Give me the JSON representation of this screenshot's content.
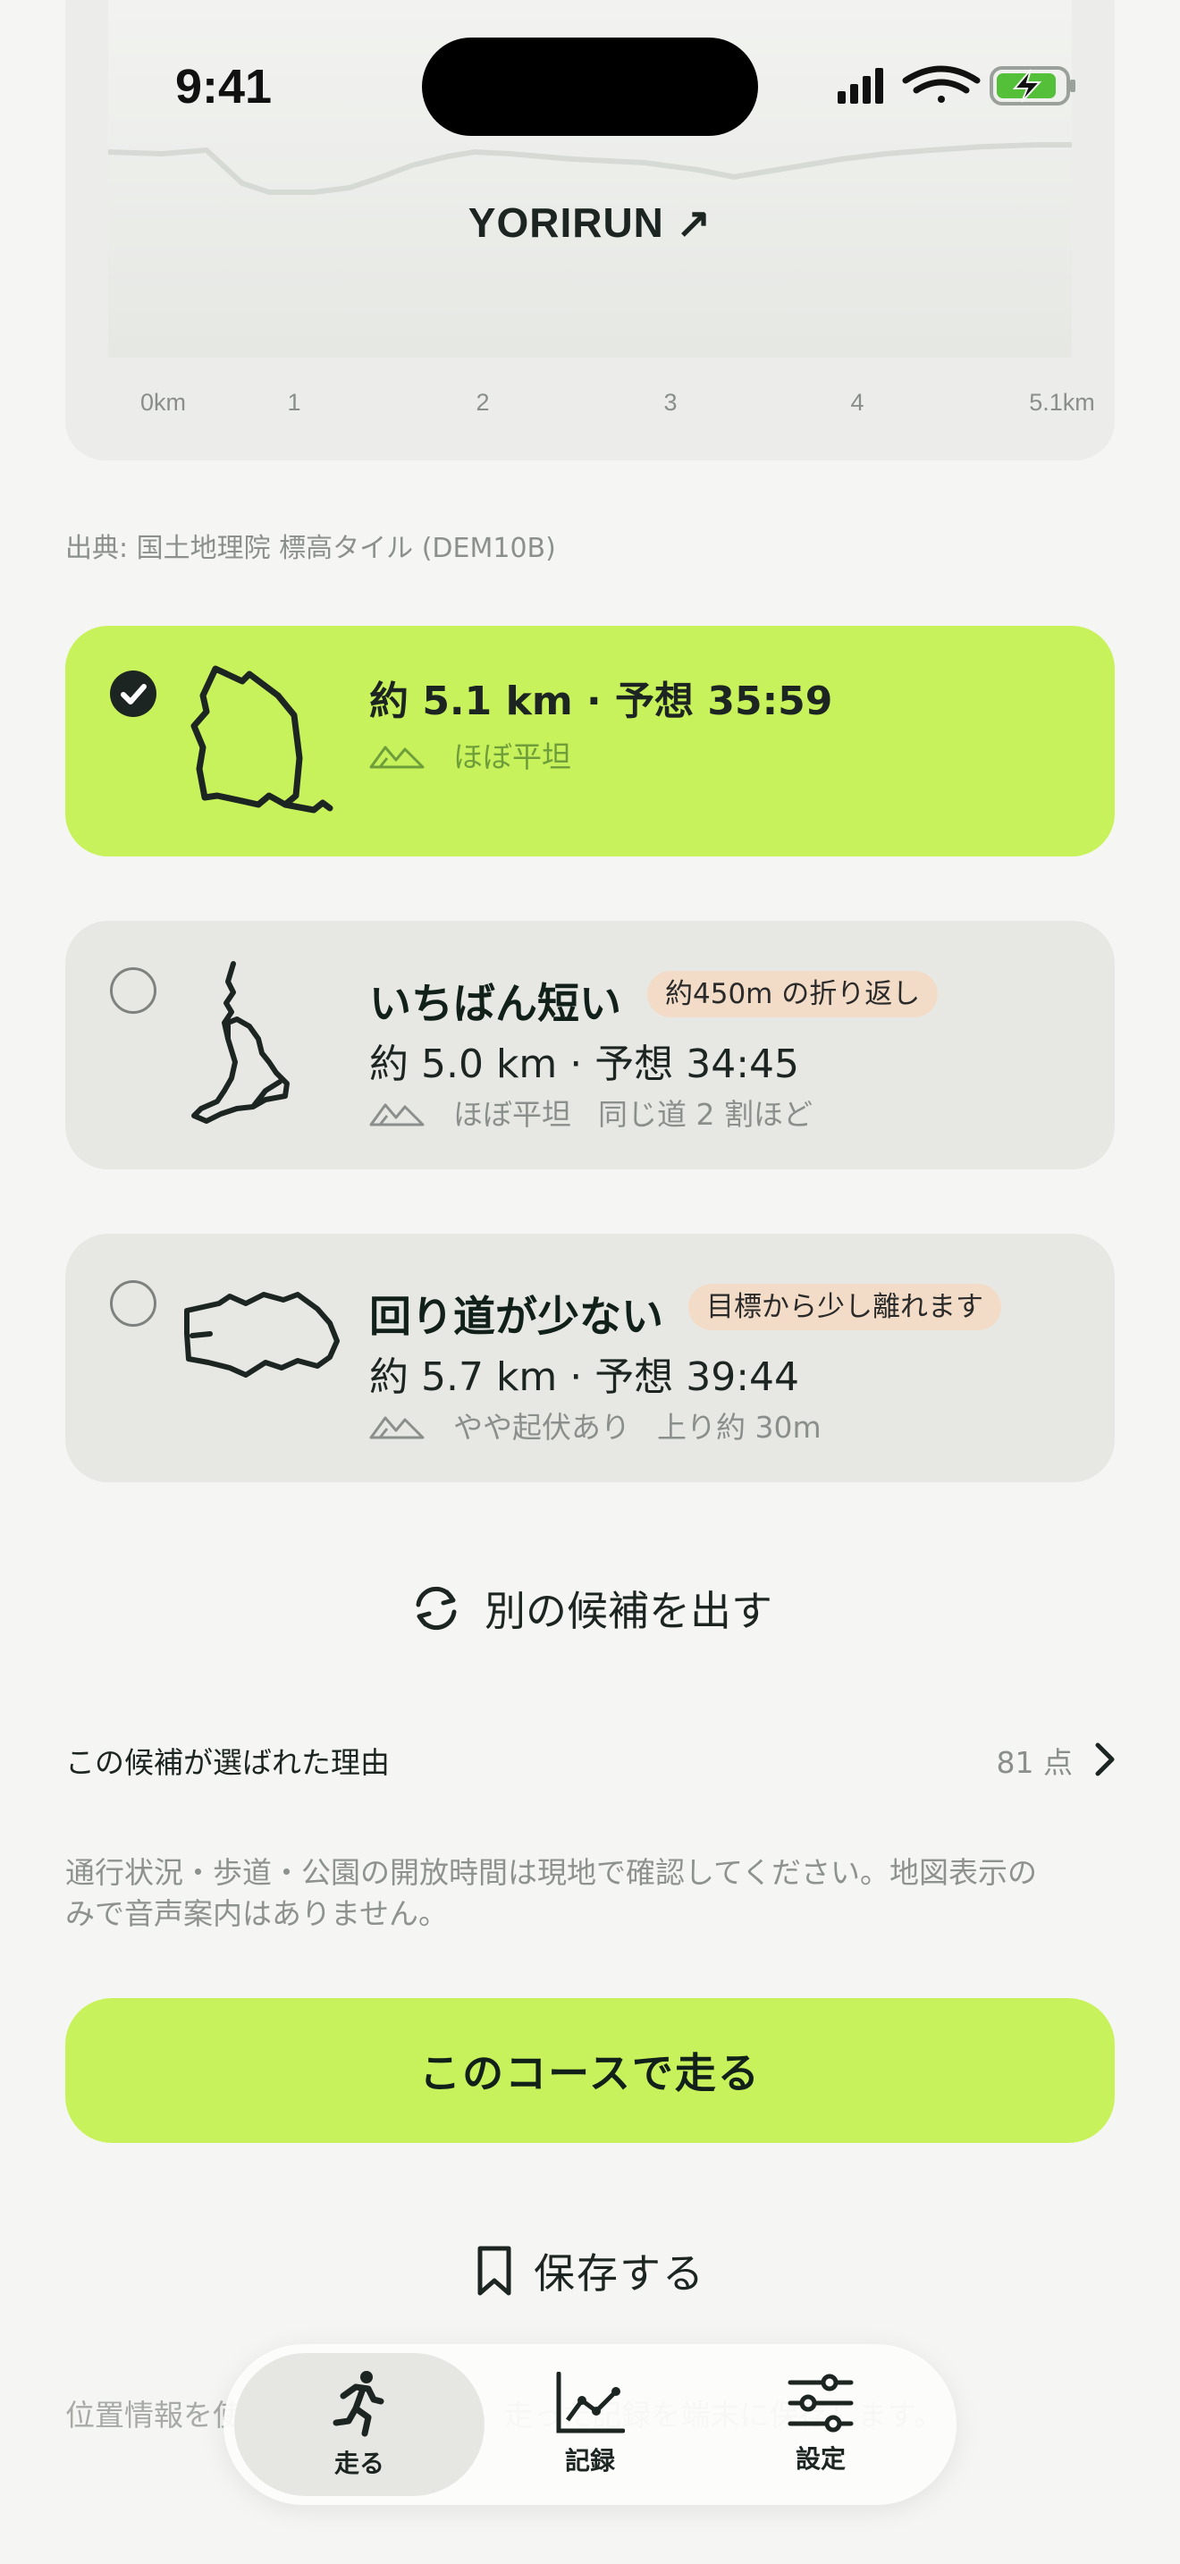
{
  "status_bar": {
    "time": "9:41"
  },
  "elevation": {
    "brand": "YORIRUN ↗",
    "ticks": [
      "0km",
      "1",
      "2",
      "3",
      "4",
      "5.1km"
    ]
  },
  "source": "出典: 国土地理院 標高タイル (DEM10B)",
  "routes": [
    {
      "selected": true,
      "distance_time": "約 5.1 km · 予想 35:59",
      "terrain": "ほぼ平坦"
    },
    {
      "selected": false,
      "title": "いちばん短い",
      "tag": "約450m の折り返し",
      "distance_time": "約 5.0 km · 予想 34:45",
      "terrain": "ほぼ平坦",
      "extra": "同じ道 2 割ほど"
    },
    {
      "selected": false,
      "title": "回り道が少ない",
      "tag": "目標から少し離れます",
      "distance_time": "約 5.7 km · 予想 39:44",
      "terrain": "やや起伏あり",
      "extra": "上り約 30m"
    }
  ],
  "actions": {
    "regenerate": "別の候補を出す",
    "reason_label": "この候補が選ばれた理由",
    "score": "81 点",
    "notice": "通行状況・歩道・公園の開放時間は現地で確認してください。地図表示のみで音声案内はありません。",
    "cta": "このコースで走る",
    "save": "保存する",
    "footer_note": "位置情報を使ってコースを作り、走った記録を端末に保存します。"
  },
  "tabbar": [
    {
      "label": "走る",
      "icon": "runner-icon",
      "active": true
    },
    {
      "label": "記録",
      "icon": "chart-icon",
      "active": false
    },
    {
      "label": "設定",
      "icon": "sliders-icon",
      "active": false
    }
  ],
  "colors": {
    "accent": "#c8f25c",
    "background": "#f5f6f3",
    "card": "#e7e8e4",
    "tag": "#f3dcc7",
    "ink": "#1c2522"
  }
}
